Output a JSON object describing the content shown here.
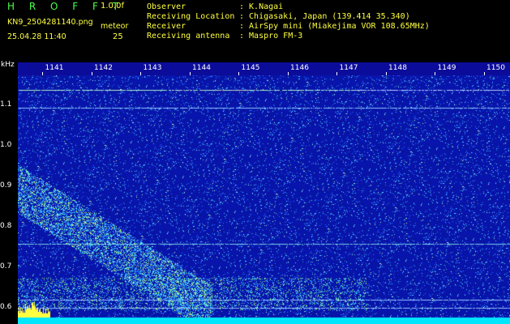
{
  "header": {
    "logo": "H R O F F T",
    "version": "1.0.0f",
    "filename": "KN9_2504281140.png",
    "meteor_label": "meteor",
    "datetime": "25.04.28 11:40",
    "meteor_count": "25"
  },
  "info": {
    "rows": [
      {
        "key": "Observer",
        "value": ": K.Nagai"
      },
      {
        "key": "Receiving Location",
        "value": ": Chigasaki, Japan (139.414 35.340)"
      },
      {
        "key": "Receiver",
        "value": ": AirSpy mini (Miakejima VOR 108.65MHz)"
      },
      {
        "key": "Receiving antenna",
        "value": ": Maspro FM-3"
      }
    ]
  },
  "axes": {
    "y_unit": "kHz",
    "x_ticks": [
      "1141",
      "1142",
      "1143",
      "1144",
      "1145",
      "1146",
      "1147",
      "1148",
      "1149",
      "1150"
    ],
    "y_ticks": [
      "1.1",
      "1.0",
      "0.9",
      "0.8",
      "0.7",
      "0.6"
    ]
  },
  "colors": {
    "background": "#000000",
    "header_text": "#ffff40",
    "logo": "#4cff4c",
    "spectrogram_base": "#0a14a0",
    "axis_bar": "#0c0c9a",
    "noise_floor": "#00e6ff"
  }
}
